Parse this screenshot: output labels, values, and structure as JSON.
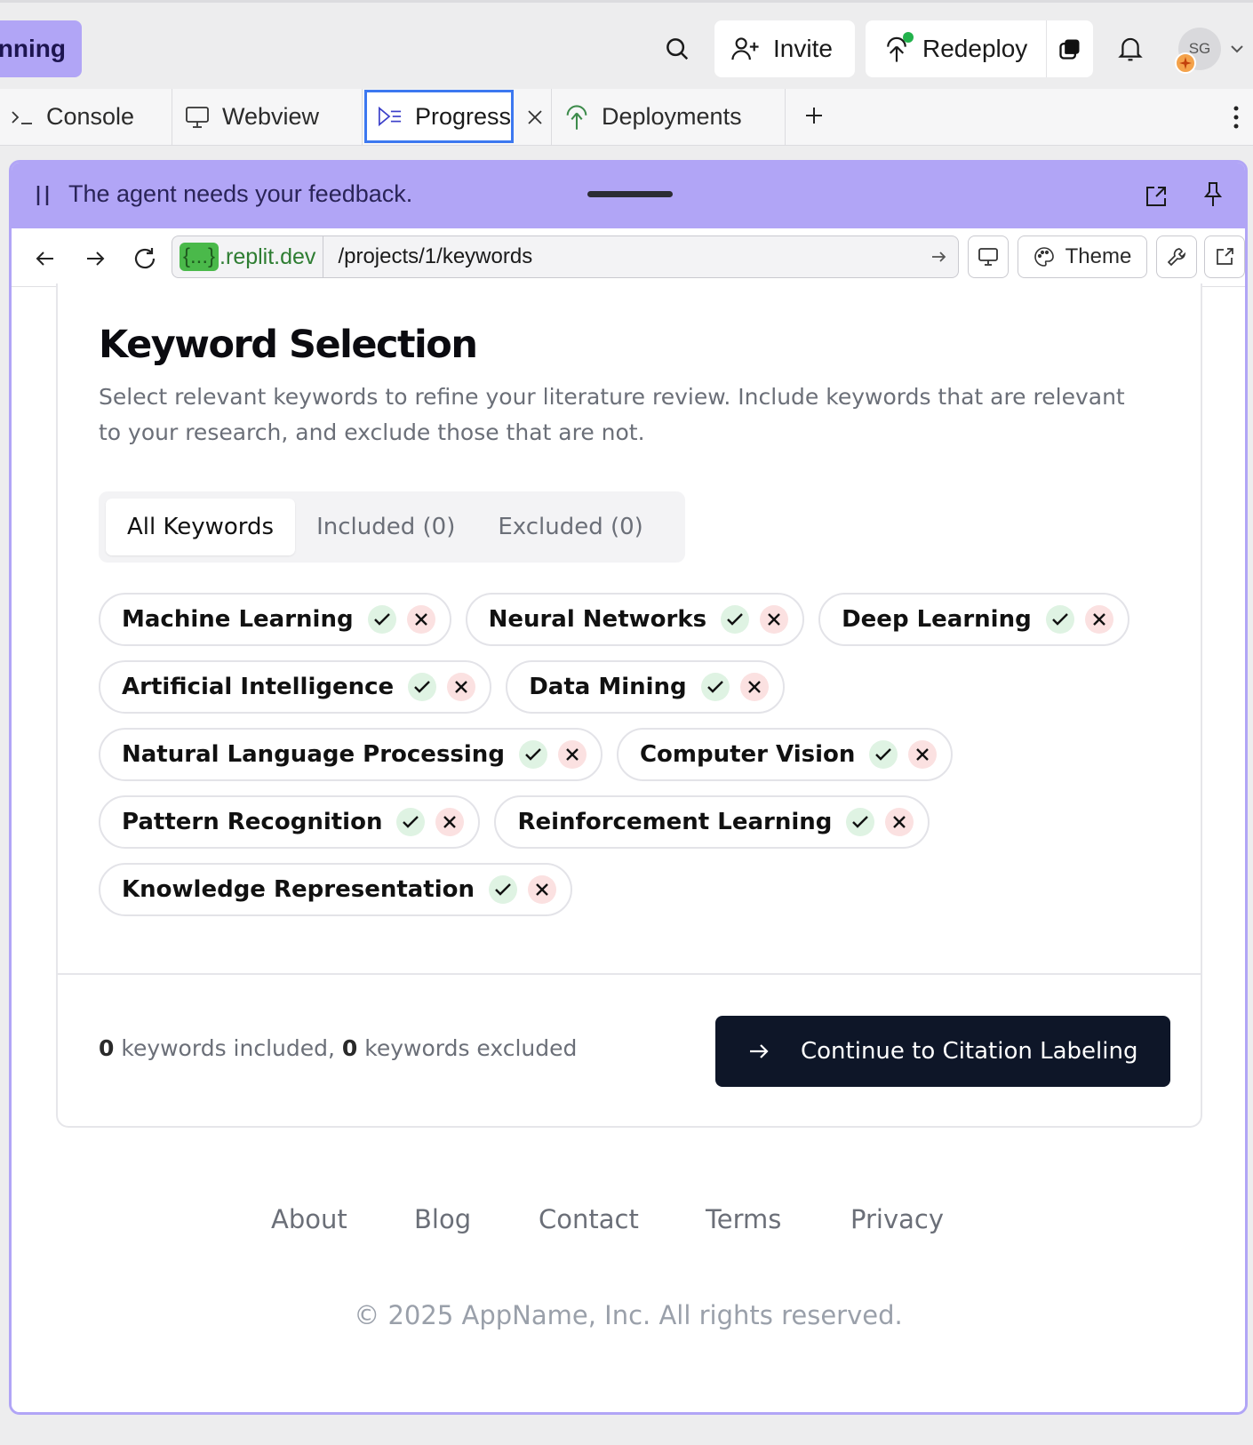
{
  "topbar": {
    "status_label": "unning",
    "invite_label": "Invite",
    "redeploy_label": "Redeploy",
    "avatar_initials": "SG"
  },
  "tabs": [
    {
      "label": "Console",
      "icon": "terminal-icon"
    },
    {
      "label": "Webview",
      "icon": "monitor-icon"
    },
    {
      "label": "Progress",
      "icon": "progress-icon",
      "active": true
    },
    {
      "label": "Deployments",
      "icon": "deploy-icon"
    }
  ],
  "panel": {
    "feedback_text": "The agent needs your feedback."
  },
  "browser": {
    "domain_tag": "{...}",
    "domain": ".replit.dev",
    "path": "/projects/1/keywords",
    "theme_label": "Theme"
  },
  "page": {
    "title": "Keyword Selection",
    "description": "Select relevant keywords to refine your literature review. Include keywords that are relevant to your research, and exclude those that are not.",
    "tabs": [
      "All Keywords",
      "Included (0)",
      "Excluded (0)"
    ],
    "keywords": [
      [
        "Machine Learning",
        "Neural Networks",
        "Deep Learning"
      ],
      [
        "Artificial Intelligence",
        "Data Mining"
      ],
      [
        "Natural Language Processing",
        "Computer Vision"
      ],
      [
        "Pattern Recognition",
        "Reinforcement Learning"
      ],
      [
        "Knowledge Representation"
      ]
    ],
    "included_count": "0",
    "included_text": " keywords included, ",
    "excluded_count": "0",
    "excluded_text": " keywords excluded",
    "continue_label": "Continue to Citation Labeling"
  },
  "footer": {
    "links": [
      "About",
      "Blog",
      "Contact",
      "Terms",
      "Privacy"
    ],
    "copyright": "© 2025 AppName, Inc. All rights reserved."
  },
  "colors": {
    "accent_purple": "#b1a5f6",
    "primary_button": "#0e1628",
    "include_green": "#dff3e3",
    "exclude_red": "#fbe1e1"
  }
}
